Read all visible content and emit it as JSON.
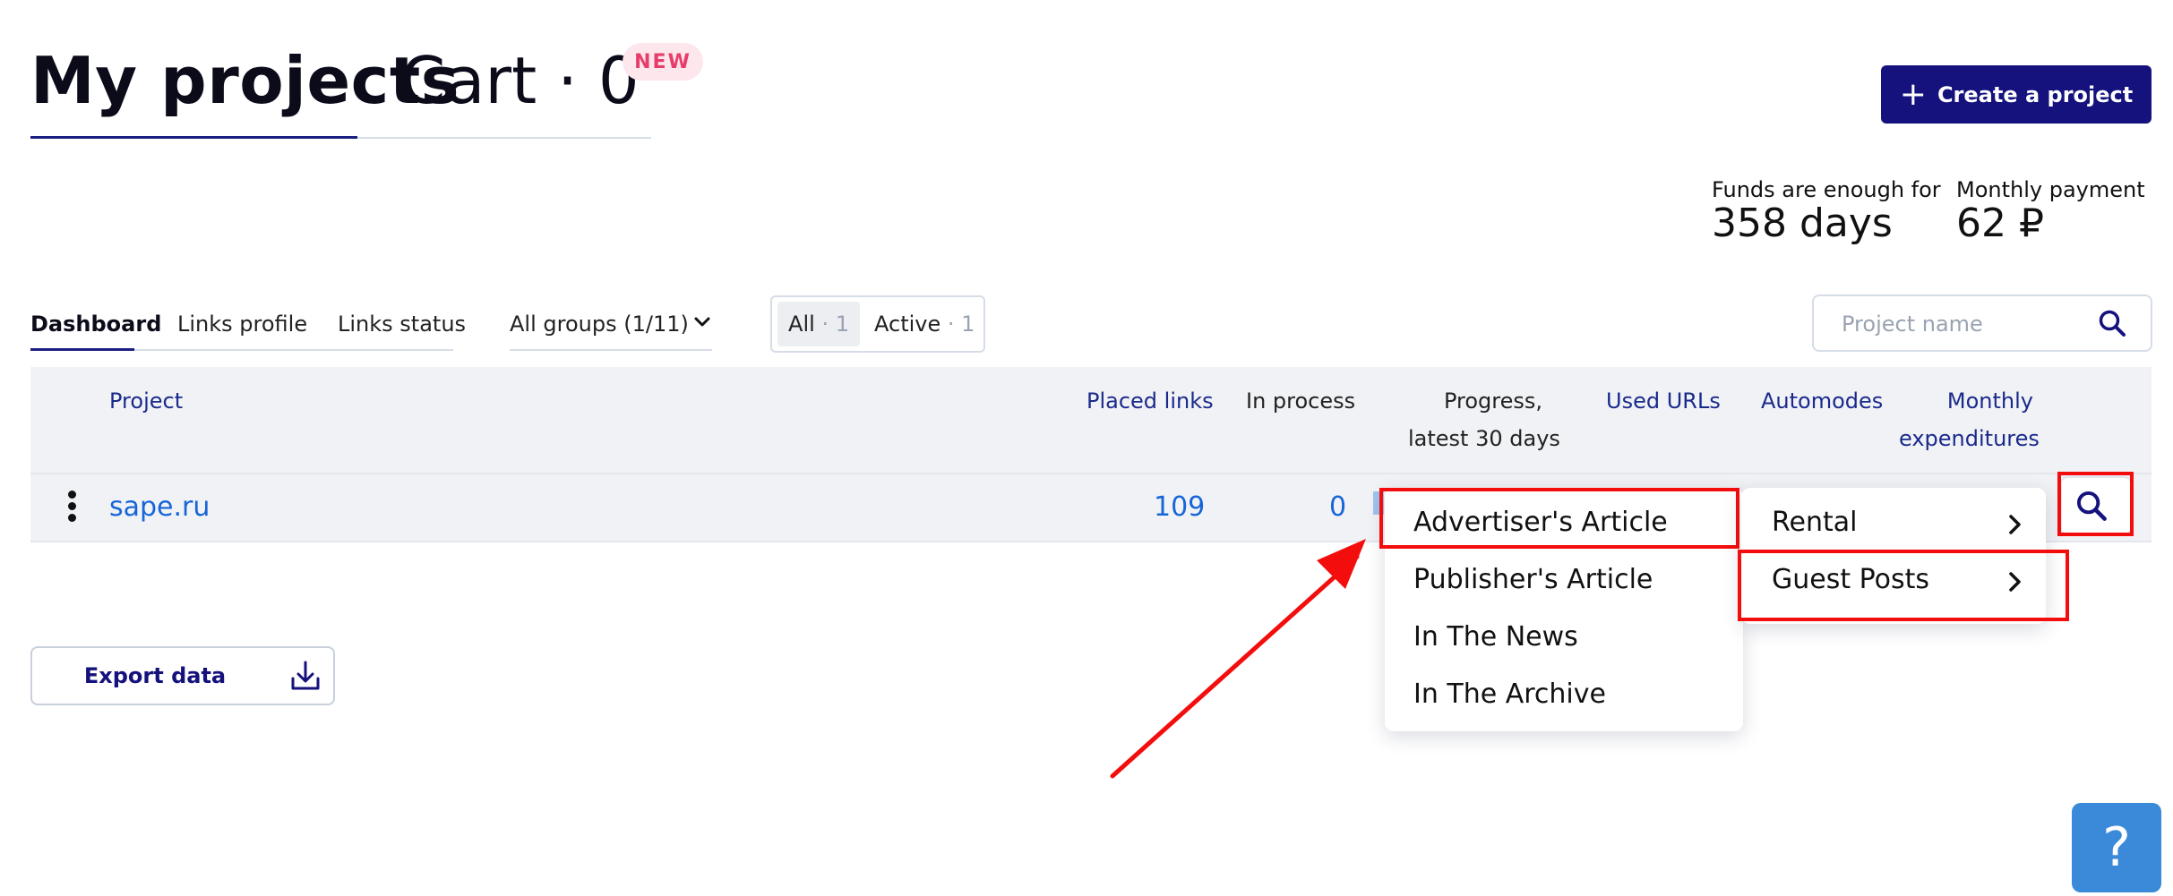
{
  "header": {
    "tab_projects": "My projects",
    "tab_cart": "Cart · 0",
    "new_badge": "NEW",
    "create_button": "Create a project"
  },
  "funds": {
    "enough_label": "Funds are enough for",
    "enough_value": "358 days",
    "monthly_label": "Monthly payment",
    "monthly_value": "62 ₽"
  },
  "subtabs": {
    "dashboard": "Dashboard",
    "links_profile": "Links profile",
    "links_status": "Links status",
    "groups": "All groups (1/11)"
  },
  "filter": {
    "all_label": "All",
    "all_count": "· 1",
    "active_label": "Active",
    "active_count": "· 1"
  },
  "search": {
    "placeholder": "Project name"
  },
  "table": {
    "headers": {
      "project": "Project",
      "placed_links": "Placed links",
      "in_process": "In process",
      "progress_line1": "Progress,",
      "progress_line2": "latest 30 days",
      "used_urls": "Used URLs",
      "automodes": "Automodes",
      "monthly_line1": "Monthly",
      "monthly_line2": "expenditures"
    },
    "rows": [
      {
        "project": "sape.ru",
        "placed_links": "109",
        "in_process": "0"
      }
    ]
  },
  "export": {
    "label": "Export data"
  },
  "menu_types": {
    "items": [
      "Advertiser's Article",
      "Publisher's Article",
      "In The News",
      "In The Archive"
    ]
  },
  "menu_modes": {
    "items": [
      "Rental",
      "Guest Posts"
    ]
  },
  "help": {
    "label": "?"
  },
  "colors": {
    "brand": "#15127d",
    "link": "#1766d8",
    "annotation": "#f40d0d",
    "badge_text": "#e73d6a",
    "help": "#3b8ad9"
  }
}
